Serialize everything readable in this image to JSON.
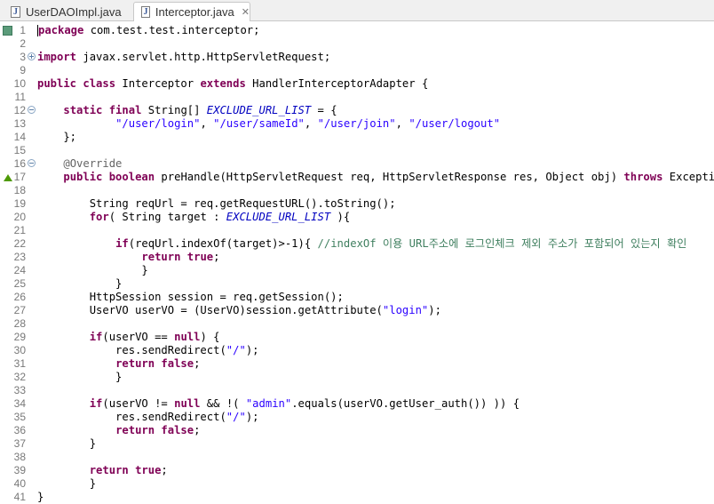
{
  "tabs": [
    {
      "label": "UserDAOImpl.java",
      "active": false
    },
    {
      "label": "Interceptor.java",
      "active": true,
      "close": "✕"
    }
  ],
  "icons": {
    "file": "java-file-icon",
    "close": "close-icon"
  },
  "editor": {
    "lines": [
      {
        "n": "1",
        "html": "<span class=\"caret\"></span><span class=\"kw\">package</span> com.test.test.interceptor;"
      },
      {
        "n": "2",
        "html": ""
      },
      {
        "n": "3",
        "html": "<span class=\"kw\">import</span> javax.servlet.http.HttpServletRequest;"
      },
      {
        "n": "9",
        "html": ""
      },
      {
        "n": "10",
        "html": "<span class=\"kw\">public class</span> Interceptor <span class=\"kw\">extends</span> HandlerInterceptorAdapter {"
      },
      {
        "n": "11",
        "html": ""
      },
      {
        "n": "12",
        "html": "    <span class=\"kw\">static final</span> String[] <span class=\"sf\">EXCLUDE_URL_LIST</span> = {"
      },
      {
        "n": "13",
        "html": "            <span class=\"st\">\"/user/login\"</span>, <span class=\"st\">\"/user/sameId\"</span>, <span class=\"st\">\"/user/join\"</span>, <span class=\"st\">\"/user/logout\"</span>"
      },
      {
        "n": "14",
        "html": "    };"
      },
      {
        "n": "15",
        "html": ""
      },
      {
        "n": "16",
        "html": "    <span class=\"an\">@Override</span>"
      },
      {
        "n": "17",
        "html": "    <span class=\"kw\">public boolean</span> preHandle(HttpServletRequest req, HttpServletResponse res, Object obj) <span class=\"kw\">throws</span> Exception {"
      },
      {
        "n": "18",
        "html": ""
      },
      {
        "n": "19",
        "html": "        String reqUrl = req.getRequestURL().toString();"
      },
      {
        "n": "20",
        "html": "        <span class=\"kw\">for</span>( String target : <span class=\"sf\">EXCLUDE_URL_LIST</span> ){"
      },
      {
        "n": "21",
        "html": ""
      },
      {
        "n": "22",
        "html": "            <span class=\"kw\">if</span>(reqUrl.indexOf(target)>-1){ <span class=\"cm\">//indexOf 이용 URL주소에 로그인체크 제외 주소가 포함되어 있는지 확인</span>"
      },
      {
        "n": "23",
        "html": "                <span class=\"kw\">return true</span>;"
      },
      {
        "n": "24",
        "html": "                }"
      },
      {
        "n": "25",
        "html": "            }"
      },
      {
        "n": "26",
        "html": "        HttpSession session = req.getSession();"
      },
      {
        "n": "27",
        "html": "        UserVO userVO = (UserVO)session.getAttribute(<span class=\"st\">\"login\"</span>);"
      },
      {
        "n": "28",
        "html": ""
      },
      {
        "n": "29",
        "html": "        <span class=\"kw\">if</span>(userVO == <span class=\"kw\">null</span>) {"
      },
      {
        "n": "30",
        "html": "            res.sendRedirect(<span class=\"st\">\"/\"</span>);"
      },
      {
        "n": "31",
        "html": "            <span class=\"kw\">return false</span>;"
      },
      {
        "n": "32",
        "html": "            }"
      },
      {
        "n": "33",
        "html": ""
      },
      {
        "n": "34",
        "html": "        <span class=\"kw\">if</span>(userVO != <span class=\"kw\">null</span> && !( <span class=\"st\">\"admin\"</span>.equals(userVO.getUser_auth()) )) {"
      },
      {
        "n": "35",
        "html": "            res.sendRedirect(<span class=\"st\">\"/\"</span>);"
      },
      {
        "n": "36",
        "html": "            <span class=\"kw\">return false</span>;"
      },
      {
        "n": "37",
        "html": "        }"
      },
      {
        "n": "38",
        "html": ""
      },
      {
        "n": "39",
        "html": "        <span class=\"kw\">return true</span>;"
      },
      {
        "n": "40",
        "html": "        }"
      },
      {
        "n": "41",
        "html": "}"
      }
    ],
    "fold_lines": {
      "3": "plus",
      "12": "minus",
      "16": "minus"
    },
    "markers": {
      "1": "bookmark",
      "17": "override"
    }
  }
}
